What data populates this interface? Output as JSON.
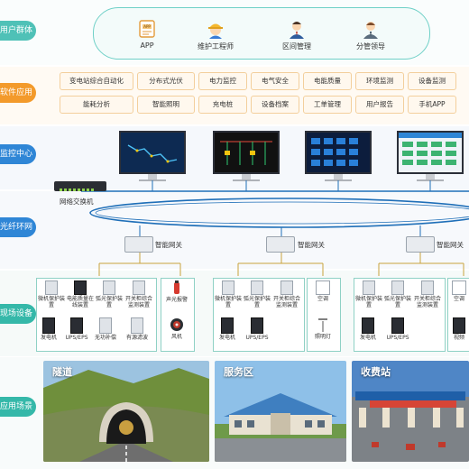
{
  "layers": [
    {
      "label": "用户群体",
      "color": "#4fc1b7"
    },
    {
      "label": "软件应用",
      "color": "#f39a2b"
    },
    {
      "label": "监控中心",
      "color": "#2f86d6"
    },
    {
      "label": "光纤环网",
      "color": "#2f86d6"
    },
    {
      "label": "现场设备",
      "color": "#35b8a9"
    },
    {
      "label": "应用场景",
      "color": "#35b8a9"
    }
  ],
  "users": [
    {
      "label": "APP",
      "icon": "app-icon"
    },
    {
      "label": "维护工程师",
      "icon": "engineer-icon"
    },
    {
      "label": "区间管理",
      "icon": "manager-icon"
    },
    {
      "label": "分管领导",
      "icon": "leader-icon"
    }
  ],
  "apps": [
    [
      "变电站综合自动化",
      "分布式光伏",
      "电力监控",
      "电气安全",
      "电能质量",
      "环境监测",
      "设备监测"
    ],
    [
      "能耗分析",
      "智能照明",
      "充电桩",
      "设备档案",
      "工单管理",
      "用户报告",
      "手机APP"
    ]
  ],
  "network": {
    "switch_label": "网络交换机",
    "gateway_label": "智能网关"
  },
  "field_groups": [
    {
      "devices": [
        {
          "label": "微机保护装置",
          "type": "panel"
        },
        {
          "label": "电能质量在线装置",
          "type": "dark"
        },
        {
          "label": "弧光保护装置",
          "type": "panel"
        },
        {
          "label": "开关柜综合监测装置",
          "type": "panel"
        },
        {
          "label": "发电机",
          "type": "dark"
        },
        {
          "label": "UPS/EPS",
          "type": "dark"
        },
        {
          "label": "无功补偿",
          "type": "panel"
        },
        {
          "label": "有源滤波",
          "type": "panel"
        }
      ],
      "extras": [
        {
          "label": "声光报警",
          "type": "alarm"
        },
        {
          "label": "风机",
          "type": "fan"
        }
      ]
    },
    {
      "devices": [
        {
          "label": "微机保护装置",
          "type": "panel"
        },
        {
          "label": "弧光保护装置",
          "type": "panel"
        },
        {
          "label": "开关柜综合监测装置",
          "type": "panel"
        },
        {
          "label": "发电机",
          "type": "dark"
        },
        {
          "label": "UPS/EPS",
          "type": "dark"
        }
      ],
      "extras": [
        {
          "label": "空调",
          "type": "ac"
        },
        {
          "label": "照明灯",
          "type": "lamp"
        }
      ]
    },
    {
      "devices": [
        {
          "label": "微机保护装置",
          "type": "panel"
        },
        {
          "label": "弧光保护装置",
          "type": "panel"
        },
        {
          "label": "开关柜综合监测装置",
          "type": "panel"
        },
        {
          "label": "发电机",
          "type": "dark"
        },
        {
          "label": "UPS/EPS",
          "type": "dark"
        }
      ],
      "extras": [
        {
          "label": "空调",
          "type": "ac"
        },
        {
          "label": "视频",
          "type": "dark"
        }
      ]
    }
  ],
  "scenes": [
    {
      "title": "隧道"
    },
    {
      "title": "服务区"
    },
    {
      "title": "收费站"
    }
  ],
  "colors": {
    "ring": "#1f6fb8",
    "user_border": "#6fd0c7",
    "app_border": "#f3cf9c",
    "band": "#f1f4f8"
  }
}
